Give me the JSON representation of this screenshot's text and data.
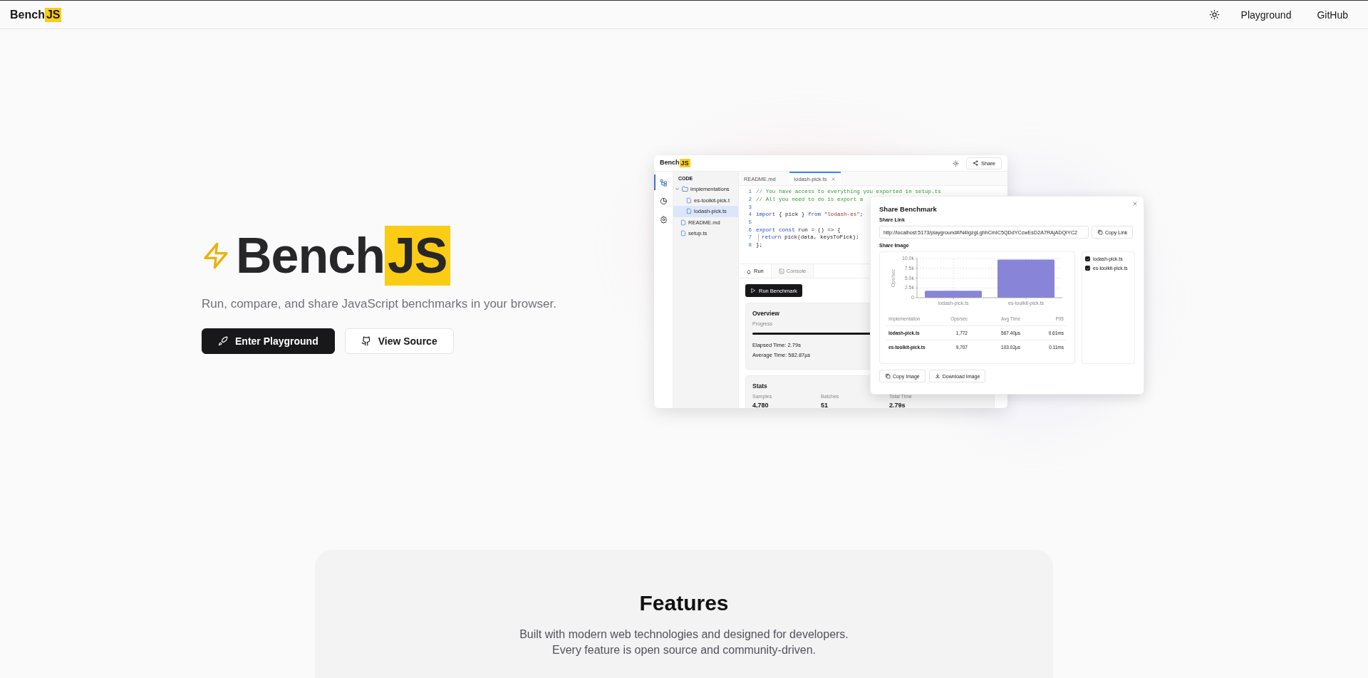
{
  "header": {
    "logo": "Bench",
    "logo_badge": "JS",
    "nav": [
      {
        "label": "Playground"
      },
      {
        "label": "GitHub"
      }
    ]
  },
  "hero": {
    "title": "Bench",
    "title_badge": "JS",
    "subtitle": "Run, compare, and share JavaScript benchmarks in your browser.",
    "buttons": [
      {
        "label": "Enter Playground",
        "kind": "primary"
      },
      {
        "label": "View Source",
        "kind": "secondary"
      }
    ]
  },
  "preview": {
    "logo": "Bench",
    "logo_badge": "JS",
    "share_button": "Share",
    "rail": [
      {
        "kind": "files",
        "selected": true
      },
      {
        "kind": "chart",
        "selected": false
      },
      {
        "kind": "settings",
        "selected": false
      }
    ],
    "sidebar": {
      "title": "CODE",
      "tree": [
        {
          "label": "implementations",
          "kind": "folder",
          "expanded": true,
          "selected": false,
          "children": [
            {
              "label": "es-toolkit-pick.t",
              "kind": "file",
              "selected": false
            },
            {
              "label": "lodash-pick.ts",
              "kind": "file",
              "selected": true
            }
          ]
        },
        {
          "label": "README.md",
          "kind": "file",
          "selected": false
        },
        {
          "label": "setup.ts",
          "kind": "file",
          "selected": false
        }
      ]
    },
    "editor_tabs": [
      {
        "label": "README.md",
        "selected": false,
        "closable": false
      },
      {
        "label": "lodash-pick.ts",
        "selected": true,
        "closable": true
      }
    ],
    "code": [
      {
        "number": "1",
        "indent_guide": false,
        "tokens": [
          {
            "text": "// You have access to everything you exported in setup.ts",
            "kind": "comment"
          }
        ]
      },
      {
        "number": "2",
        "indent_guide": false,
        "tokens": [
          {
            "text": "// All you need to do is export a",
            "kind": "comment"
          }
        ]
      },
      {
        "number": "3",
        "indent_guide": false
      },
      {
        "number": "4",
        "indent_guide": false,
        "tokens": [
          {
            "text": "import",
            "kind": "keyword"
          },
          {
            "text": " { pick } ",
            "kind": "plain"
          },
          {
            "text": "from",
            "kind": "keyword"
          },
          {
            "text": " \"lodash-es\"",
            "kind": "string"
          },
          {
            "text": ";",
            "kind": "plain"
          }
        ]
      },
      {
        "number": "5",
        "indent_guide": false
      },
      {
        "number": "6",
        "indent_guide": false,
        "tokens": [
          {
            "text": "export const",
            "kind": "keyword"
          },
          {
            "text": " run = () => {",
            "kind": "plain"
          }
        ]
      },
      {
        "number": "7",
        "indent_guide": true,
        "tokens": [
          {
            "text": "return",
            "kind": "keyword"
          },
          {
            "text": " pick(data, keysToPick);",
            "kind": "plain"
          }
        ]
      },
      {
        "number": "8",
        "indent_guide": false,
        "tokens": [
          {
            "text": "};",
            "kind": "plain"
          }
        ]
      }
    ],
    "panel_tabs": [
      {
        "label": "Run",
        "kind": "run",
        "selected": true
      },
      {
        "label": "Console",
        "kind": "console",
        "selected": false
      }
    ],
    "run_button": "Run Benchmark",
    "overview": {
      "title": "Overview",
      "progress_label": "Progress",
      "level": 1,
      "lines": [
        "Elapsed Time: 2.79s",
        "Average Time: 582.87µs"
      ]
    },
    "stats": {
      "title": "Stats",
      "items": [
        {
          "label": "Samples",
          "value": "4,780"
        },
        {
          "label": "Batches",
          "value": "51"
        },
        {
          "label": "Total Time",
          "value": "2.79s"
        }
      ]
    },
    "share_dialog": {
      "title": "Share Benchmark",
      "link_label": "Share Link",
      "link": "http://localhost:5173/playground#/N4IgzgLghhCmIC5QDdYCcwEsD2A7RAjADQIYC2",
      "copy_link": "Copy Link",
      "image_label": "Share Image",
      "chart_data": {
        "type": "bar",
        "ylabel": "Ops/sec",
        "grid": true,
        "categories": [
          "lodash-pick.ts",
          "es-toolkit-pick.ts"
        ],
        "series": [
          {
            "color": "#8884d8",
            "values": [
              1772,
              9707
            ]
          }
        ],
        "ylim": [
          0,
          10000
        ],
        "yticks": [
          {
            "value": 0,
            "label": "0"
          },
          {
            "value": 2500,
            "label": "2.5k"
          },
          {
            "value": 5000,
            "label": "5.0k"
          },
          {
            "value": 7500,
            "label": "7.5k"
          },
          {
            "value": 10000,
            "label": "10.0k"
          }
        ]
      },
      "table": {
        "columns": [
          "Implementation",
          "Ops/sec",
          "Avg Time",
          "P95"
        ],
        "rows": [
          [
            "lodash-pick.ts",
            "1,772",
            "567.40µs",
            "0.61ms"
          ],
          [
            "es-toolkit-pick.ts",
            "9,707",
            "103.02µs",
            "0.11ms"
          ]
        ]
      },
      "filters": [
        {
          "label": "lodash-pick.ts",
          "checked": true
        },
        {
          "label": "es-toolkit-pick.ts",
          "checked": true
        }
      ],
      "actions": [
        {
          "label": "Copy Image",
          "kind": "copy"
        },
        {
          "label": "Download Image",
          "kind": "download"
        }
      ]
    }
  },
  "features": {
    "title": "Features",
    "lines": [
      "Built with modern web technologies and designed for developers.",
      "Every feature is open source and community-driven."
    ]
  }
}
